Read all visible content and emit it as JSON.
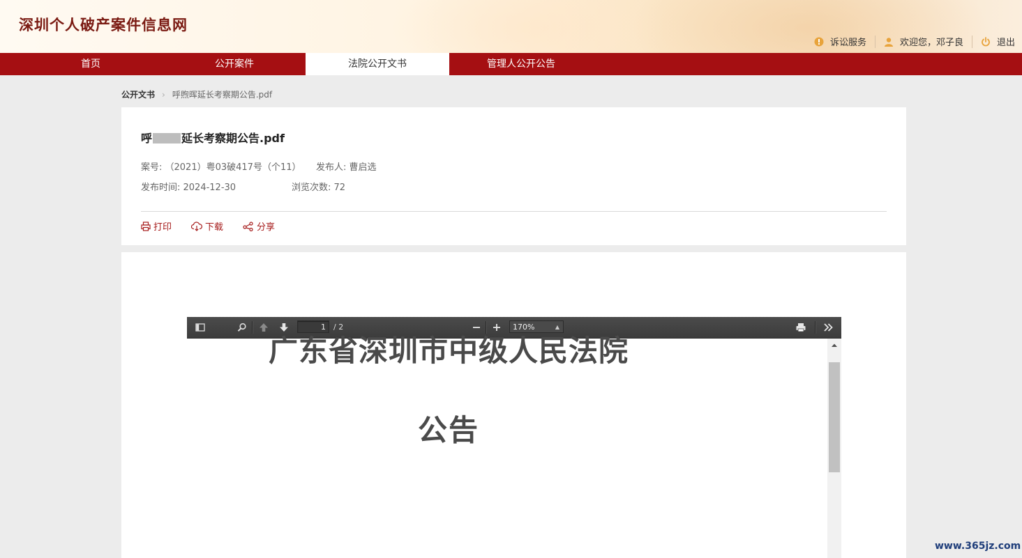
{
  "site": {
    "title": "深圳个人破产案件信息网"
  },
  "userbar": {
    "litigation": "诉讼服务",
    "welcome": "欢迎您，邓子良",
    "logout": "退出"
  },
  "nav": {
    "items": [
      {
        "label": "首页"
      },
      {
        "label": "公开案件"
      },
      {
        "label": "法院公开文书"
      },
      {
        "label": "管理人公开公告"
      }
    ],
    "active_index": 2
  },
  "breadcrumb": {
    "root": "公开文书",
    "current": "呼煦晖延长考察期公告.pdf"
  },
  "document": {
    "title_prefix": "呼",
    "title_suffix": "延长考察期公告.pdf",
    "case_no": "案号: （2021）粤03破417号（个11）",
    "publisher": "发布人: 曹启选",
    "publish_time": "发布时间: 2024-12-30",
    "views": "浏览次数: 72"
  },
  "actions": {
    "print": "打印",
    "download": "下载",
    "share": "分享"
  },
  "pdf_viewer": {
    "current_page": "1",
    "total_pages": "/ 2",
    "zoom": "170%",
    "content": {
      "court_name": "广东省深圳市中级人民法院",
      "heading": "公告"
    }
  },
  "watermark": "www.365jz.com",
  "colors": {
    "nav_red": "#a50f12",
    "title_red": "#7a1a12",
    "action_red": "#a61b1b",
    "icon_gold": "#e8a33b"
  }
}
